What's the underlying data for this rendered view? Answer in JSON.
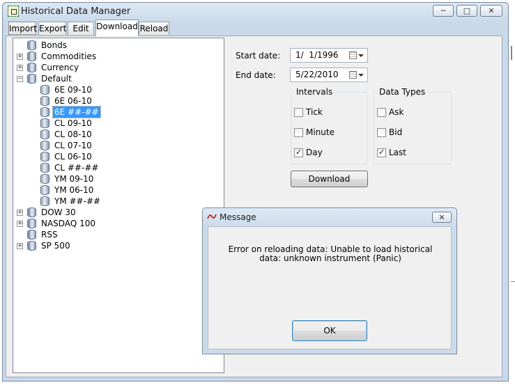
{
  "window": {
    "title": "Historical Data Manager",
    "controls": {
      "minimize": "─",
      "maximize": "□",
      "close": "✕"
    }
  },
  "tabs": [
    {
      "label": "Import",
      "active": false
    },
    {
      "label": "Export",
      "active": false
    },
    {
      "label": "Edit",
      "active": false
    },
    {
      "label": "Download",
      "active": true
    },
    {
      "label": "Reload",
      "active": false
    }
  ],
  "tree": {
    "nodes": [
      {
        "label": "Bonds",
        "expander": "",
        "level": 0
      },
      {
        "label": "Commodities",
        "expander": "+",
        "level": 0
      },
      {
        "label": "Currency",
        "expander": "+",
        "level": 0
      },
      {
        "label": "Default",
        "expander": "−",
        "level": 0
      },
      {
        "label": "6E 09-10",
        "expander": "",
        "level": 1
      },
      {
        "label": "6E 06-10",
        "expander": "",
        "level": 1
      },
      {
        "label": "6E ##-##",
        "expander": "",
        "level": 1,
        "selected": true
      },
      {
        "label": "CL 09-10",
        "expander": "",
        "level": 1
      },
      {
        "label": "CL 08-10",
        "expander": "",
        "level": 1
      },
      {
        "label": "CL 07-10",
        "expander": "",
        "level": 1
      },
      {
        "label": "CL 06-10",
        "expander": "",
        "level": 1
      },
      {
        "label": "CL ##-##",
        "expander": "",
        "level": 1
      },
      {
        "label": "YM 09-10",
        "expander": "",
        "level": 1
      },
      {
        "label": "YM 06-10",
        "expander": "",
        "level": 1
      },
      {
        "label": "YM ##-##",
        "expander": "",
        "level": 1
      },
      {
        "label": "DOW 30",
        "expander": "+",
        "level": 0
      },
      {
        "label": "NASDAQ 100",
        "expander": "+",
        "level": 0
      },
      {
        "label": "RSS",
        "expander": "",
        "level": 0
      },
      {
        "label": "SP 500",
        "expander": "+",
        "level": 0
      }
    ]
  },
  "download": {
    "start_label": "Start date:",
    "start_value": "1/  1/1996",
    "end_label": "End date:",
    "end_value": "5/22/2010",
    "intervals": {
      "title": "Intervals",
      "tick": {
        "label": "Tick",
        "checked": false
      },
      "minute": {
        "label": "Minute",
        "checked": false
      },
      "day": {
        "label": "Day",
        "checked": true
      }
    },
    "types": {
      "title": "Data Types",
      "ask": {
        "label": "Ask",
        "checked": false
      },
      "bid": {
        "label": "Bid",
        "checked": false
      },
      "last": {
        "label": "Last",
        "checked": true
      }
    },
    "button": "Download"
  },
  "dialog": {
    "title": "Message",
    "message": "Error on reloading data: Unable to load historical data: unknown instrument (Panic)",
    "ok": "OK",
    "close": "✕"
  },
  "colors": {
    "selection": "#3399ff",
    "title_bar": "#c9d9ea"
  }
}
